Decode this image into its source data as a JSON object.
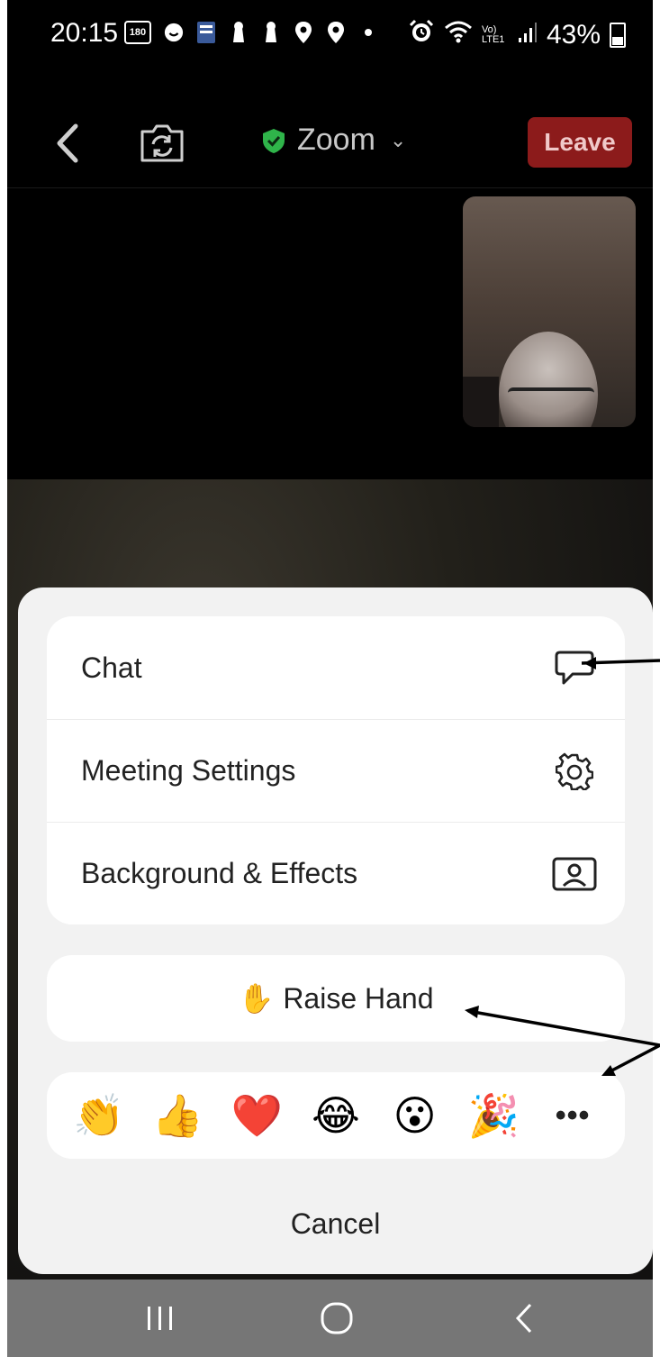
{
  "status_bar": {
    "time": "20:15",
    "badge_180": "180",
    "network": "Vo) LTE1",
    "battery_percent": "43%"
  },
  "top_bar": {
    "title": "Zoom",
    "leave_label": "Leave",
    "leave_color": "#8c1b1b",
    "shield_color": "#2fb44a"
  },
  "menu": {
    "items": [
      {
        "label": "Chat",
        "icon": "chat-bubble-icon"
      },
      {
        "label": "Meeting Settings",
        "icon": "gear-icon"
      },
      {
        "label": "Background & Effects",
        "icon": "portrait-frame-icon"
      }
    ]
  },
  "raise_hand": {
    "emoji": "✋",
    "label": "Raise Hand"
  },
  "reactions": {
    "emojis": [
      "👏",
      "👍",
      "❤️",
      "😂",
      "😮",
      "🎉"
    ],
    "more_label": "•••"
  },
  "cancel_label": "Cancel"
}
